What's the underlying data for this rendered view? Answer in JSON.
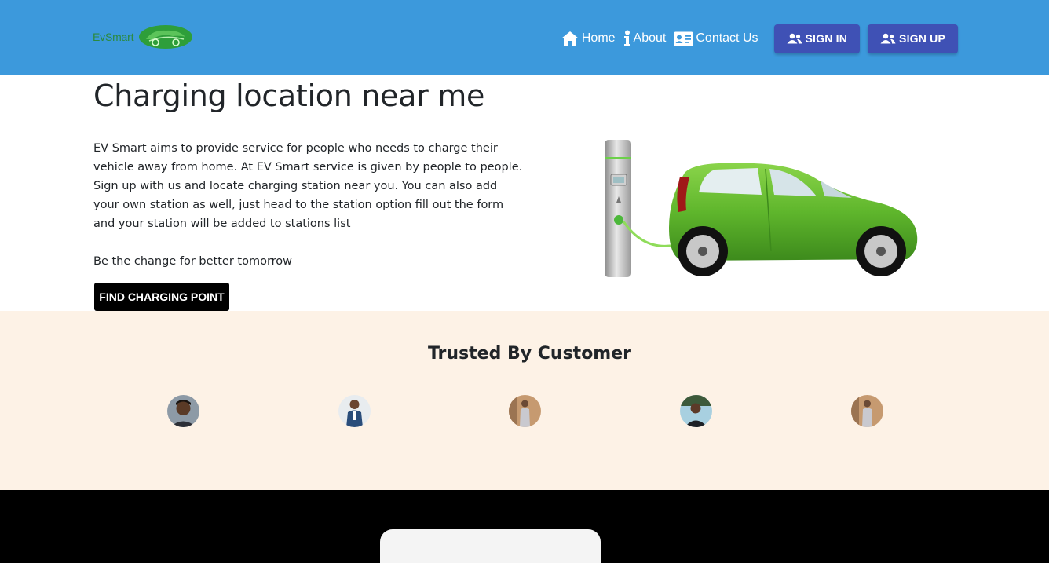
{
  "navbar": {
    "brand_text": "EvSmart",
    "logo_icon": "car-leaf-logo",
    "links": [
      {
        "label": "Home",
        "icon": "home-icon"
      },
      {
        "label": "About",
        "icon": "info-icon"
      },
      {
        "label": "Contact Us",
        "icon": "contact-card-icon"
      }
    ],
    "buttons": [
      {
        "label": "SIGN IN",
        "icon": "users-icon"
      },
      {
        "label": "SIGN UP",
        "icon": "users-icon"
      }
    ],
    "colors": {
      "background": "#3c99dc",
      "button": "#3f51b5"
    }
  },
  "hero": {
    "title": "Charging location near me",
    "description": "EV Smart aims to provide service for people who needs to charge their vehicle away from home. At EV Smart service is given by people to people. Sign up with us and locate charging station near you. You can also add your own station as well, just head to the station option fill out the form and your station will be added to stations list",
    "tagline": "Be the change for better tomorrow",
    "cta_label": "FIND CHARGING POINT",
    "image": "green-electric-car-charging-station"
  },
  "trusted": {
    "title": "Trusted By Customer",
    "background": "#fdf2e6",
    "avatars": [
      "customer-avatar-1",
      "customer-avatar-2",
      "customer-avatar-3",
      "customer-avatar-4",
      "customer-avatar-5"
    ]
  },
  "footer": {
    "background": "#000000"
  }
}
